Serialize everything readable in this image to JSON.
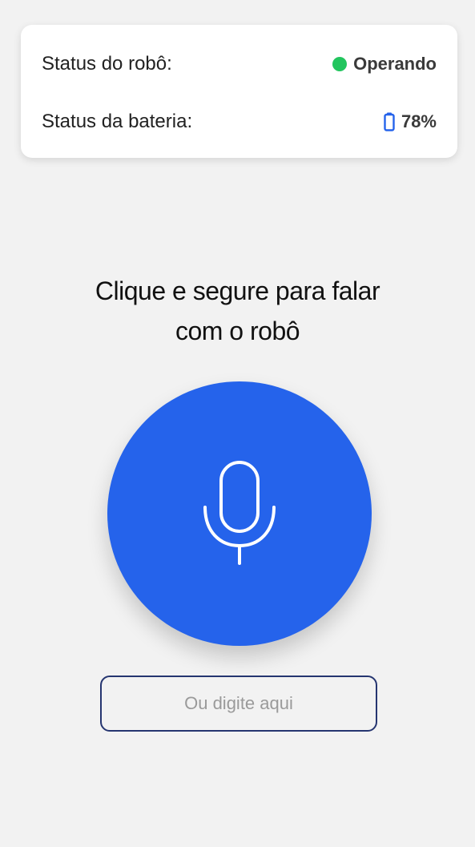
{
  "status_card": {
    "robot_label": "Status do robô:",
    "robot_value": "Operando",
    "robot_status_color": "#22c55e",
    "battery_label": "Status da bateria:",
    "battery_value": "78%",
    "battery_icon": "battery-icon",
    "battery_icon_color": "#2563eb"
  },
  "prompt": {
    "line1": "Clique e segure para falar",
    "line2": "com o robô"
  },
  "mic": {
    "icon": "microphone-icon",
    "color": "#2563eb"
  },
  "text_input": {
    "placeholder": "Ou digite aqui",
    "value": ""
  }
}
